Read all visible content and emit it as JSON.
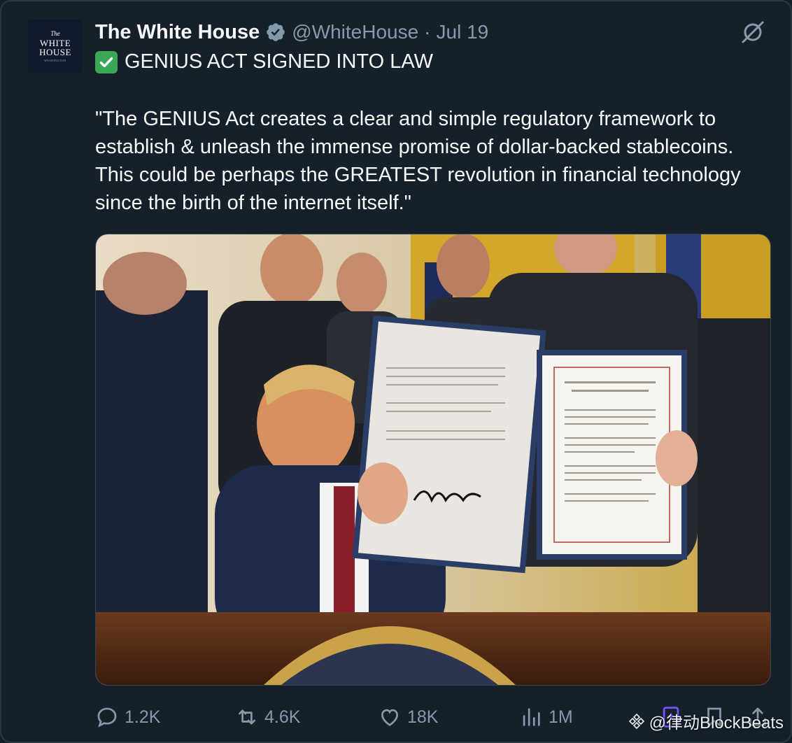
{
  "account": {
    "name": "The White House",
    "handle": "@WhiteHouse",
    "separator": "·",
    "date": "Jul 19",
    "avatar_text": {
      "small": "The",
      "line1": "WHITE",
      "line2": "HOUSE",
      "tiny": "WASHINGTON"
    }
  },
  "tweet": {
    "headline": "GENIUS ACT SIGNED INTO LAW",
    "headline_icon": "check-mark-emoji",
    "body": "\"The GENIUS Act creates a clear and simple regulatory framework to establish & unleash the immense promise of dollar-backed stablecoins. This could be perhaps the GREATEST revolution in financial technology since the birth of the internet itself.\""
  },
  "actions": {
    "reply_count": "1.2K",
    "retweet_count": "4.6K",
    "like_count": "18K",
    "views_count": "1M"
  },
  "watermark": "@律动BlockBeats",
  "colors": {
    "background": "#15202b",
    "text_primary": "#f7f9f9",
    "text_secondary": "#8b98a5",
    "verified": "#829aab",
    "grok_accent": "#7856ff"
  }
}
